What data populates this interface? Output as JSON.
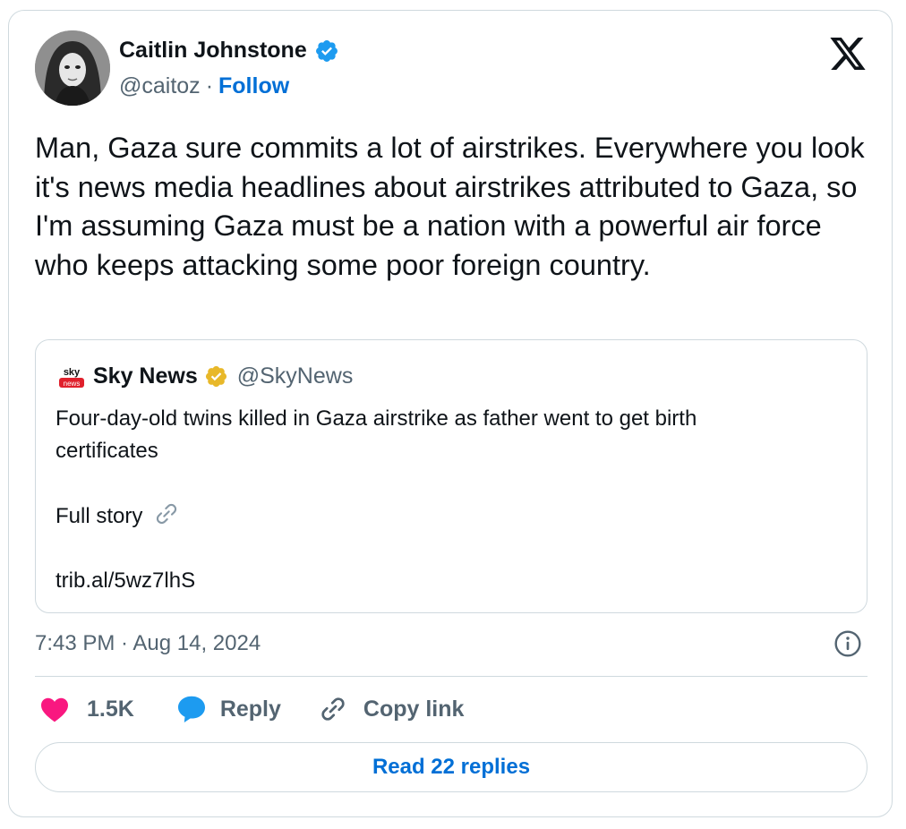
{
  "author": {
    "name": "Caitlin Johnstone",
    "handle": "@caitoz",
    "separator": "·",
    "follow_label": "Follow",
    "verified_icon": "verified-badge-icon",
    "verified_color": "#1d9bf0"
  },
  "platform_logo": "x-logo-icon",
  "tweet": {
    "text": "Man, Gaza sure commits a lot of airstrikes. Everywhere you look it's news media headlines about airstrikes attributed to Gaza, so I'm assuming Gaza must be a nation with a powerful air force who keeps attacking some poor foreign country."
  },
  "quoted_tweet": {
    "name": "Sky News",
    "handle": "@SkyNews",
    "avatar_text_top": "sky",
    "avatar_text_bottom": "news",
    "verified_icon": "gold-verified-badge-icon",
    "verified_color": "#e8b829",
    "text_line1": "Four-day-old twins killed in Gaza airstrike as father went to get birth",
    "text_line2": "certificates",
    "full_story": "Full story",
    "link": "trib.al/5wz7lhS"
  },
  "timestamp": "7:43 PM · Aug 14, 2024",
  "actions": {
    "like_count": "1.5K",
    "reply_label": "Reply",
    "copy_link_label": "Copy link"
  },
  "read_replies_label": "Read 22 replies",
  "colors": {
    "accent": "#006fd6",
    "like": "#f91880",
    "reply_bubble": "#1d9bf0",
    "muted": "#536471",
    "border": "#cfd9de"
  }
}
